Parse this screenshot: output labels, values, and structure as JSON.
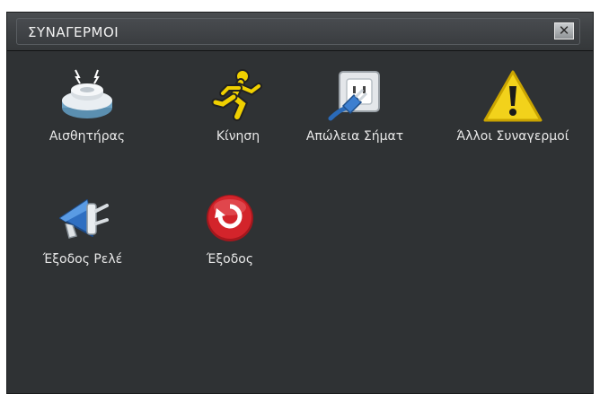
{
  "window": {
    "title": "ΣΥΝΑΓΕΡΜΟΙ",
    "close_symbol": "✕"
  },
  "menu": {
    "items": [
      {
        "label": "Αισθητήρας",
        "icon": "smoke-detector-icon"
      },
      {
        "label": "Κίνηση",
        "icon": "running-man-icon"
      },
      {
        "label": "Απώλεια Σήματ",
        "icon": "power-plug-icon"
      },
      {
        "label": "Άλλοι Συναγερμοί",
        "icon": "warning-icon"
      },
      {
        "label": "Έξοδος Ρελέ",
        "icon": "relay-output-icon"
      },
      {
        "label": "Έξοδος",
        "icon": "exit-icon"
      }
    ]
  },
  "colors": {
    "panel_background": "#2f3234",
    "text": "#e8e8e8",
    "warning_yellow": "#f2d21b",
    "exit_red": "#d3242b",
    "runner_yellow": "#f0d000"
  }
}
